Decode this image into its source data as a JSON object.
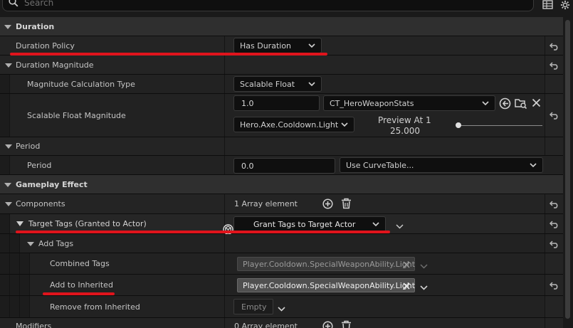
{
  "search": {
    "placeholder": "Search"
  },
  "sections": {
    "duration": "Duration",
    "gameplay_effect": "Gameplay Effect"
  },
  "rows": {
    "duration_policy": {
      "label": "Duration Policy",
      "value": "Has Duration"
    },
    "duration_magnitude": {
      "label": "Duration Magnitude"
    },
    "magnitude_calc_type": {
      "label": "Magnitude Calculation Type",
      "value": "Scalable Float"
    },
    "scalable_float": {
      "label": "Scalable Float Magnitude",
      "value": "1.0",
      "curve_table": "CT_HeroWeaponStats",
      "row_name": "Hero.Axe.Cooldown.Light",
      "preview_label": "Preview At 1",
      "preview_value": "25.000",
      "preview_slider": 0.0
    },
    "period_group": {
      "label": "Period"
    },
    "period": {
      "label": "Period",
      "value": "0.0",
      "curve": "Use CurveTable..."
    },
    "components": {
      "label": "Components",
      "value": "1 Array element"
    },
    "target_tags": {
      "label": "Target Tags (Granted to Actor)",
      "value": "Grant Tags to Target Actor"
    },
    "add_tags": {
      "label": "Add Tags"
    },
    "combined_tags": {
      "label": "Combined Tags",
      "tag": "Player.Cooldown.SpecialWeaponAbility.Light"
    },
    "add_to_inherited": {
      "label": "Add to Inherited",
      "tag": "Player.Cooldown.SpecialWeaponAbility.Light"
    },
    "remove_from_inherited": {
      "label": "Remove from Inherited",
      "value": "Empty"
    },
    "modifiers": {
      "label": "Modifiers",
      "value": "0 Array element"
    }
  },
  "colors": {
    "annotation": "#e0141c",
    "background": "#1a1a1a",
    "category": "#2f2f2f"
  },
  "icons": [
    "search-icon",
    "grid-icon",
    "gear-icon",
    "reset-arrow-icon",
    "chevron-down-icon",
    "browse-icon",
    "folder-search-icon",
    "close-icon",
    "plus-circle-icon",
    "trash-icon",
    "grant-tags-icon"
  ]
}
